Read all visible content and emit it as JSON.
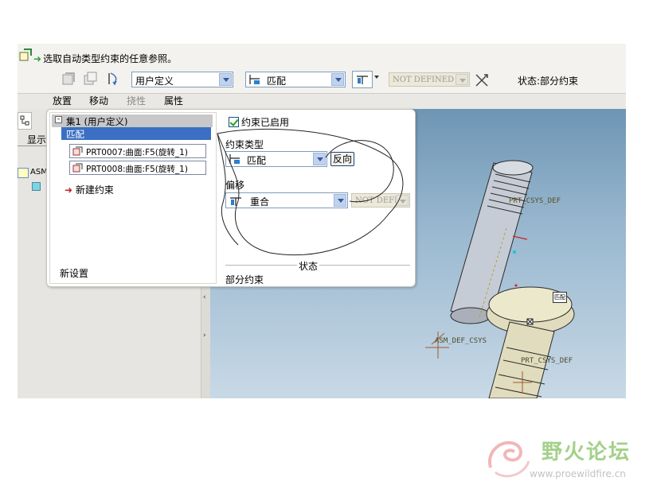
{
  "toolbar": {
    "prompt": "选取自动类型约束的任意参照。",
    "mode_select": "用户定义",
    "constraint_select": "匹配",
    "offset_disabled": "NOT DEFINED",
    "status_text": "状态:部分约束"
  },
  "tabs": [
    "放置",
    "移动",
    "挠性",
    "属性"
  ],
  "left_panel": {
    "tab_label": "显示",
    "tree_item": "ASM"
  },
  "placement_panel": {
    "set_header": "集1 (用户定义)",
    "selected_constraint": "匹配",
    "refs": [
      "PRT0007:曲面:F5(旋转_1)",
      "PRT0008:曲面:F5(旋转_1)"
    ],
    "new_constraint": "新建约束",
    "new_set": "新设置",
    "enabled_label": "约束已启用",
    "type_label": "约束类型",
    "type_value": "匹配",
    "flip_button": "反向",
    "offset_label": "偏移",
    "offset_value": "重合",
    "offset_disabled": "NOT DEFIN",
    "status_label": "状态",
    "status_value": "部分约束"
  },
  "viewport": {
    "labels": [
      "PRT_CSYS_DEF",
      "ASM_DEF_CSYS",
      "PRT_CSYS_DEF"
    ],
    "tag_label": "匹配"
  },
  "watermark": {
    "name": "野火论坛",
    "url": "www.proewildfire.cn"
  },
  "colors": {
    "accent_green": "#2aa33a",
    "selected_row": "#3a6fc4",
    "viewport_top": "#6e95b4",
    "part_blue": "#c6ccd6",
    "part_tan": "#e0dcbd"
  }
}
